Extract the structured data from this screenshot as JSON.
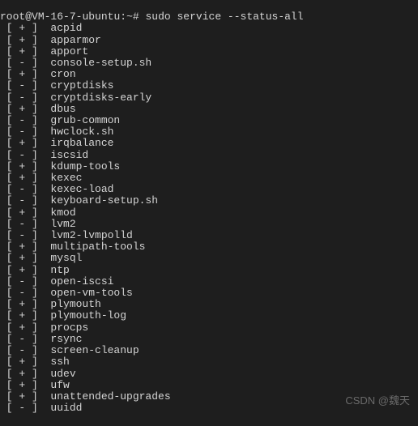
{
  "prompt": {
    "user": "root",
    "host": "VM-16-7-ubuntu",
    "path": "~",
    "symbol": "#",
    "command": "sudo service --status-all"
  },
  "services": [
    {
      "status": "+",
      "name": "acpid"
    },
    {
      "status": "+",
      "name": "apparmor"
    },
    {
      "status": "+",
      "name": "apport"
    },
    {
      "status": "-",
      "name": "console-setup.sh"
    },
    {
      "status": "+",
      "name": "cron"
    },
    {
      "status": "-",
      "name": "cryptdisks"
    },
    {
      "status": "-",
      "name": "cryptdisks-early"
    },
    {
      "status": "+",
      "name": "dbus"
    },
    {
      "status": "-",
      "name": "grub-common"
    },
    {
      "status": "-",
      "name": "hwclock.sh"
    },
    {
      "status": "+",
      "name": "irqbalance"
    },
    {
      "status": "-",
      "name": "iscsid"
    },
    {
      "status": "+",
      "name": "kdump-tools"
    },
    {
      "status": "+",
      "name": "kexec"
    },
    {
      "status": "-",
      "name": "kexec-load"
    },
    {
      "status": "-",
      "name": "keyboard-setup.sh"
    },
    {
      "status": "+",
      "name": "kmod"
    },
    {
      "status": "-",
      "name": "lvm2"
    },
    {
      "status": "-",
      "name": "lvm2-lvmpolld"
    },
    {
      "status": "+",
      "name": "multipath-tools"
    },
    {
      "status": "+",
      "name": "mysql"
    },
    {
      "status": "+",
      "name": "ntp"
    },
    {
      "status": "-",
      "name": "open-iscsi"
    },
    {
      "status": "-",
      "name": "open-vm-tools"
    },
    {
      "status": "+",
      "name": "plymouth"
    },
    {
      "status": "+",
      "name": "plymouth-log"
    },
    {
      "status": "+",
      "name": "procps"
    },
    {
      "status": "-",
      "name": "rsync"
    },
    {
      "status": "-",
      "name": "screen-cleanup"
    },
    {
      "status": "+",
      "name": "ssh"
    },
    {
      "status": "+",
      "name": "udev"
    },
    {
      "status": "+",
      "name": "ufw"
    },
    {
      "status": "+",
      "name": "unattended-upgrades"
    },
    {
      "status": "-",
      "name": "uuidd"
    }
  ],
  "watermark": "CSDN @魏天"
}
